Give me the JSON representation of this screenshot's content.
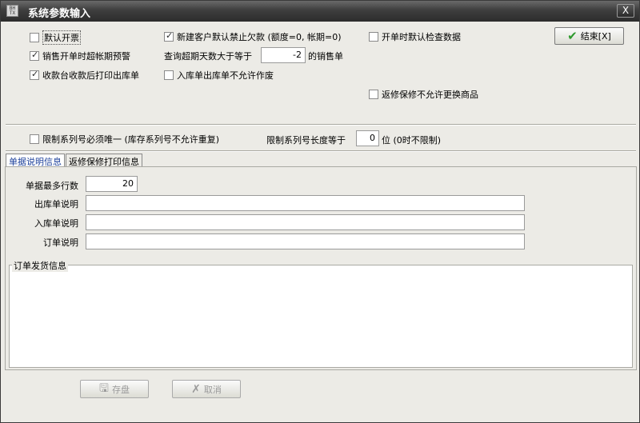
{
  "window": {
    "title": "系统参数输入",
    "icon_text": "BH\nTX",
    "close_label": "X"
  },
  "options": {
    "default_invoice": {
      "label": "默认开票",
      "checked": false
    },
    "new_customer_ban_credit": {
      "label": "新建客户默认禁止欠款 (额度=0, 帐期=0)",
      "checked": true
    },
    "default_check_data": {
      "label": "开单时默认检查数据",
      "checked": false
    },
    "sales_overdue_warning": {
      "label": "销售开单时超帐期预警",
      "checked": true
    },
    "query_overdue_prefix": "查询超期天数大于等于",
    "query_overdue_value": "-2",
    "query_overdue_suffix": "的销售单",
    "print_after_cashier": {
      "label": "收款台收款后打印出库单",
      "checked": true
    },
    "no_void_inout": {
      "label": "入库单出库单不允许作废",
      "checked": false
    },
    "repair_no_exchange": {
      "label": "返修保修不允许更换商品",
      "checked": false
    },
    "serial_unique": {
      "label": "限制系列号必须唯一 (库存系列号不允许重复)",
      "checked": false
    },
    "serial_len_prefix": "限制系列号长度等于",
    "serial_len_value": "0",
    "serial_len_suffix": "位 (0时不限制)"
  },
  "finish_button": {
    "label": "结束[X]"
  },
  "tabs": [
    {
      "label": "单据说明信息",
      "active": true
    },
    {
      "label": "返修保修打印信息",
      "active": false
    }
  ],
  "doc_fields": {
    "max_rows_label": "单据最多行数",
    "max_rows_value": "20",
    "outbound_label": "出库单说明",
    "outbound_value": "",
    "inbound_label": "入库单说明",
    "inbound_value": "",
    "order_label": "订单说明",
    "order_value": ""
  },
  "shipping_group": {
    "title": "订单发货信息",
    "value": ""
  },
  "bottom_buttons": {
    "save_label": "存盘",
    "cancel_label": "取消"
  },
  "colors": {
    "title_bar": "#3e3e3e",
    "window_bg": "#ecebe6",
    "finish_check": "#2e9a2e",
    "active_tab_text": "#1b3f9a"
  }
}
